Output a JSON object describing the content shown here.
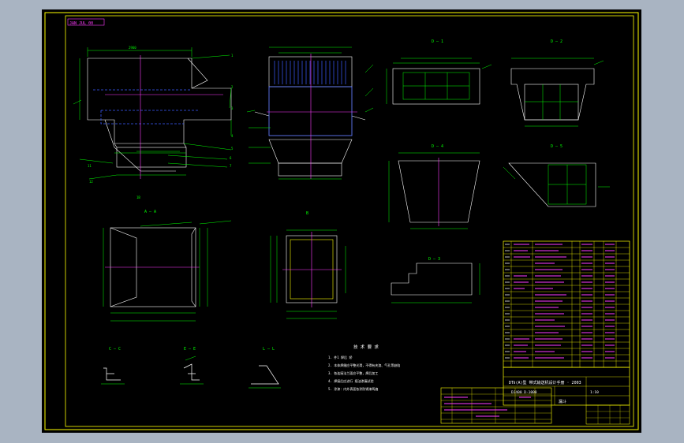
{
  "drawing": {
    "top_tag": "JAN JUL 00",
    "view_label_aa": "A – A",
    "view_label_bb": "B",
    "view_label_d1": "D – 1",
    "view_label_d2": "D – 2",
    "view_label_d3": "D – 3",
    "view_label_d4": "D – 4",
    "view_label_d5": "D – 5",
    "section_cc": "C – C",
    "section_ee": "E – E",
    "section_ll": "L – L",
    "notes_title": "技 术 要 求",
    "notes": [
      "1. 件1 焊后 矫",
      "2. 本体焊缝应平整光滑，不得有夹渣、气孔等缺陷",
      "3. 各连接法兰面应平整，焊后加工",
      "4. 焊接后应进行 煤油渗漏试验",
      "5. 涂漆：内外表面各涂防锈漆两遍"
    ],
    "title_block": {
      "company": "DTⅡ(A)型 带式输送机设计手册 · 2003",
      "drawing_name": "漏斗",
      "drawing_no": "DJ400 D-1000",
      "scale_text": "1:10"
    }
  }
}
